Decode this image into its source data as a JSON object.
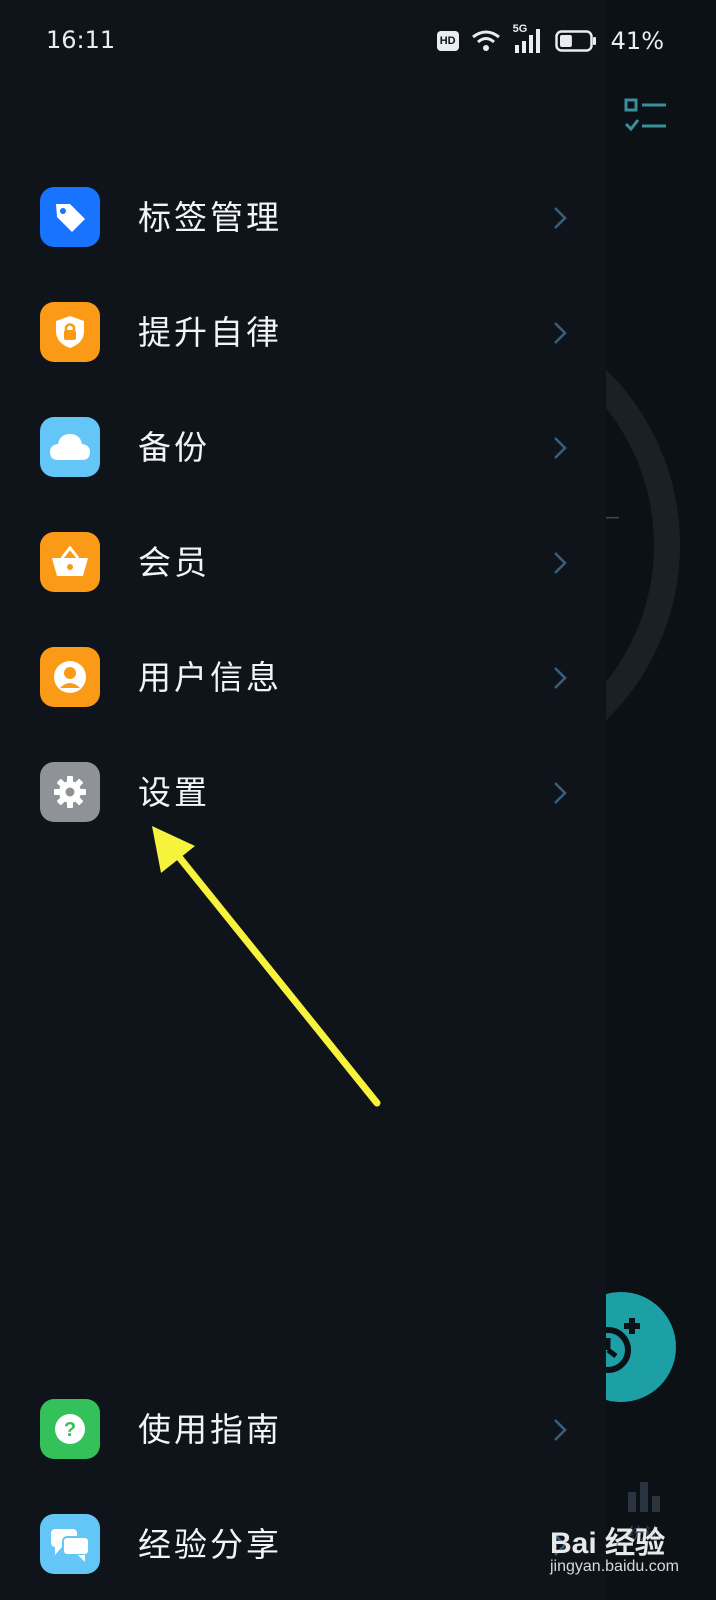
{
  "status_bar": {
    "time": "16:11",
    "hd_label": "HD",
    "network_label": "5G",
    "battery_percent": "41%",
    "battery_level": 0.41
  },
  "menu": {
    "items": [
      {
        "label": "标签管理",
        "icon": "tag-icon",
        "color": "#1873ff"
      },
      {
        "label": "提升自律",
        "icon": "shield-lock-icon",
        "color": "#fb9a17"
      },
      {
        "label": "备份",
        "icon": "cloud-icon",
        "color": "#63c6f6"
      },
      {
        "label": "会员",
        "icon": "basket-icon",
        "color": "#fb9a17"
      },
      {
        "label": "用户信息",
        "icon": "user-icon",
        "color": "#fb9a17"
      },
      {
        "label": "设置",
        "icon": "gear-icon",
        "color": "#8f9398"
      }
    ],
    "bottom_items": [
      {
        "label": "使用指南",
        "icon": "help-icon",
        "color": "#34c15a"
      },
      {
        "label": "经验分享",
        "icon": "chat-icon",
        "color": "#63c6f6"
      }
    ]
  },
  "background_app": {
    "stats_label": "统计"
  },
  "annotation": {
    "arrow_color": "#f7f23c",
    "target": "设置"
  },
  "watermark": {
    "brand": "Bai  经验",
    "url": "jingyan.baidu.com"
  }
}
